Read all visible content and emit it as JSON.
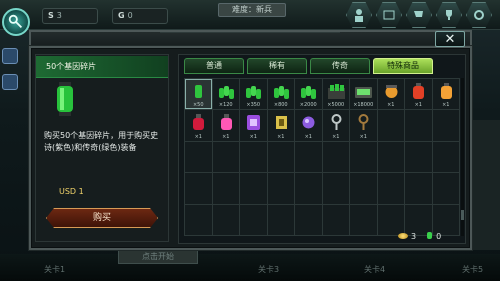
{
  "hud": {
    "res1_glyph": "S",
    "res1_value": "3",
    "res2_glyph": "G",
    "res2_value": "0",
    "difficulty": "难度：新兵"
  },
  "dialog": {
    "close_glyph": "✕"
  },
  "item": {
    "title": "50个基因碎片",
    "description": "购买50个基因碎片，用于购买史诗(紫色)和传奇(绿色)装备",
    "price": "USD 1",
    "buy_label": "购买"
  },
  "tabs": [
    {
      "label": "普通"
    },
    {
      "label": "稀有"
    },
    {
      "label": "传奇"
    },
    {
      "label": "特殊商品"
    }
  ],
  "items_row1": [
    {
      "qty": "×50",
      "icon": "green-gene-capsule-icon"
    },
    {
      "qty": "×120",
      "icon": "green-gene-capsule-pile-icon"
    },
    {
      "qty": "×350",
      "icon": "green-gene-capsule-pile-icon"
    },
    {
      "qty": "×800",
      "icon": "green-gene-capsule-pile-icon"
    },
    {
      "qty": "×2000",
      "icon": "green-gene-capsule-pile-icon"
    },
    {
      "qty": "×5000",
      "icon": "green-gene-capsule-crate-icon"
    },
    {
      "qty": "×18000",
      "icon": "green-gene-capsule-case-icon"
    },
    {
      "qty": "×1",
      "icon": "orange-drone-icon"
    },
    {
      "qty": "×1",
      "icon": "red-potion-icon"
    },
    {
      "qty": "×1",
      "icon": "orange-potion-icon"
    }
  ],
  "items_row2": [
    {
      "qty": "×1",
      "icon": "red-flask-icon"
    },
    {
      "qty": "×1",
      "icon": "pink-flask-icon"
    },
    {
      "qty": "×1",
      "icon": "purple-card-icon"
    },
    {
      "qty": "×1",
      "icon": "yellow-chip-icon"
    },
    {
      "qty": "×1",
      "icon": "purple-orb-icon"
    },
    {
      "qty": "×1",
      "icon": "gray-key-icon"
    },
    {
      "qty": "×1",
      "icon": "brown-key-icon"
    }
  ],
  "footer": {
    "coins": "3",
    "gems": "0"
  },
  "background": {
    "stage1": "关卡1",
    "stage3": "关卡3",
    "stage4": "关卡4",
    "stage5": "关卡5",
    "start": "点击开始"
  }
}
